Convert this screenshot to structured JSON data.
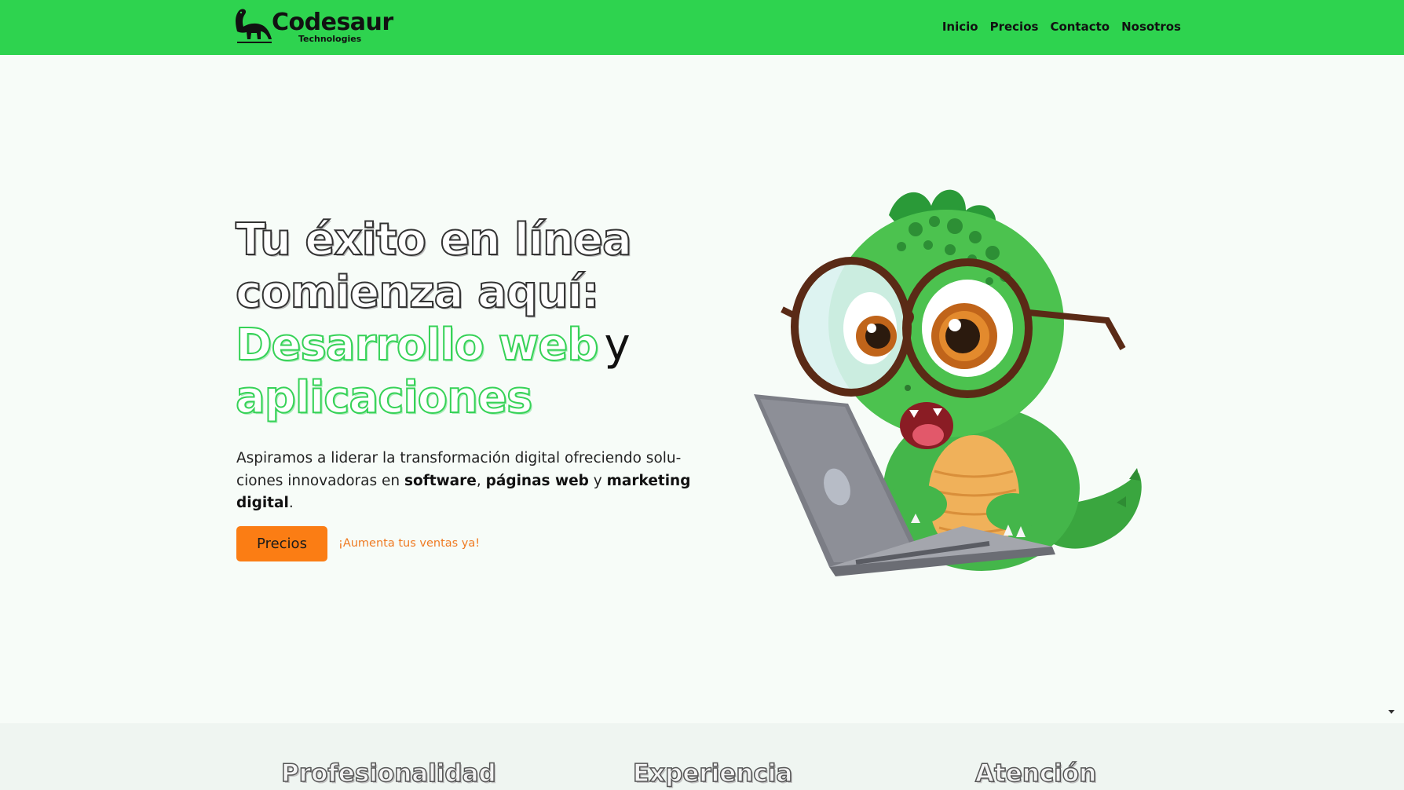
{
  "brand": {
    "name": "Codesaur",
    "subtitle": "Technologies"
  },
  "nav": {
    "items": [
      {
        "label": "Inicio"
      },
      {
        "label": "Precios"
      },
      {
        "label": "Contacto"
      },
      {
        "label": "Nosotros"
      }
    ]
  },
  "hero": {
    "title_line1": "Tu éxito en línea",
    "title_line2": "comienza aquí:",
    "title_line3": "Desarrollo web",
    "title_connector": "y",
    "title_line4": "aplicaciones",
    "description": {
      "part1": "Aspiramos a liderar la transformación digital ofreciendo solu-ciones innovadoras en ",
      "bold1": "software",
      "part2": ", ",
      "bold2": "páginas web",
      "part3": " y ",
      "bold3": "marketing digital",
      "part4": "."
    },
    "cta_button": "Precios",
    "cta_note": "¡Aumenta tus ventas ya!",
    "illustration": "dinosaur-with-glasses-and-laptop"
  },
  "features": {
    "items": [
      {
        "title": "Profesionalidad"
      },
      {
        "title": "Experiencia"
      },
      {
        "title": "Atención"
      }
    ]
  },
  "colors": {
    "nav_background": "#2ed34f",
    "accent_green": "#36d257",
    "button_orange": "#fb7d14",
    "note_orange": "#ef7a22",
    "page_background": "#f7fcf8",
    "features_background": "#eff5f1"
  }
}
